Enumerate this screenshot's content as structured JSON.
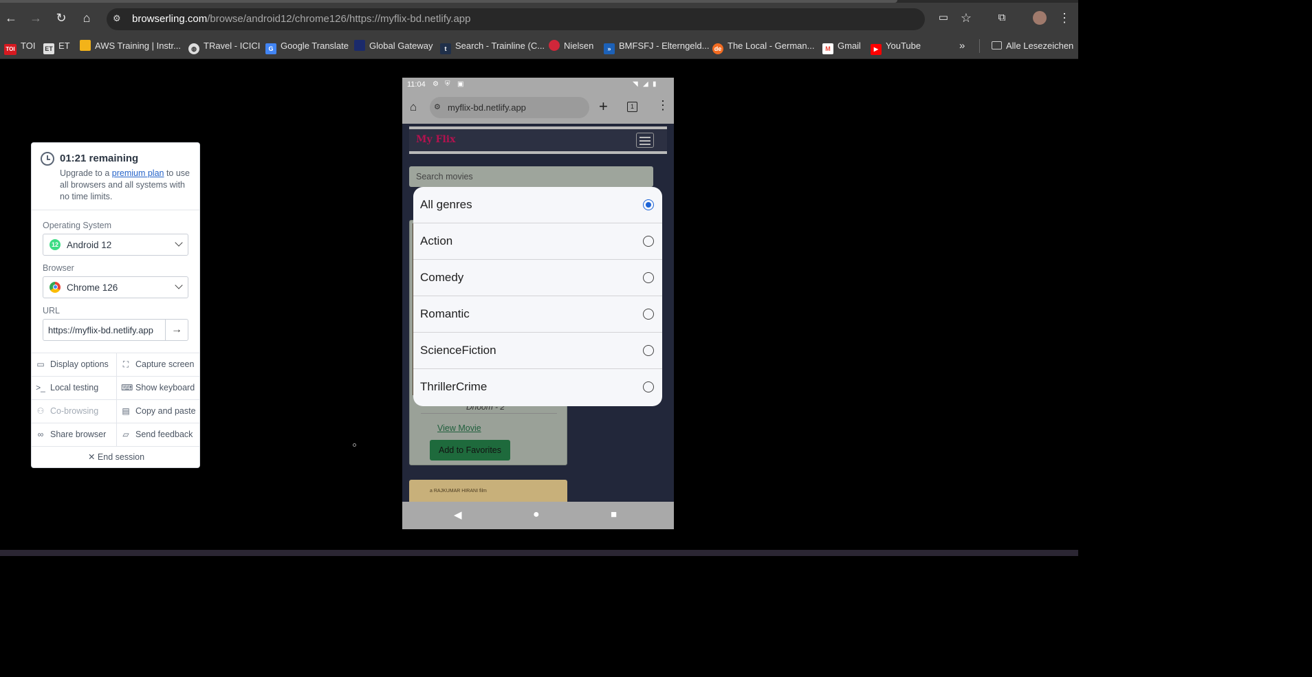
{
  "browser": {
    "omnibox": {
      "host": "browserling.com",
      "path": "/browse/android12/chrome126/https://myflix-bd.netlify.app"
    },
    "bookmarks": [
      {
        "label": "TOI",
        "fav": "TOI",
        "color": "#d71920"
      },
      {
        "label": "ET",
        "fav": "ET",
        "color": "#e0e0e0"
      },
      {
        "label": "AWS Training | Instr...",
        "fav": "",
        "color": "#f3b319"
      },
      {
        "label": "TRavel - ICICI",
        "fav": "",
        "color": "#dddddd"
      },
      {
        "label": "Google Translate",
        "fav": "G",
        "color": "#4285f4"
      },
      {
        "label": "Global Gateway",
        "fav": "",
        "color": "#1b2a6b"
      },
      {
        "label": "Search - Trainline (C...",
        "fav": "t",
        "color": "#20304a"
      },
      {
        "label": "Nielsen",
        "fav": "",
        "color": "#d0273a"
      },
      {
        "label": "BMFSFJ - Elterngeld...",
        "fav": "»",
        "color": "#1c61b8"
      },
      {
        "label": "The Local - German...",
        "fav": "de",
        "color": "#f26b21"
      },
      {
        "label": "Gmail",
        "fav": "M",
        "color": "#ea4335"
      },
      {
        "label": "YouTube",
        "fav": "▶",
        "color": "#ff0000"
      }
    ],
    "all_bookmarks": "Alle Lesezeichen"
  },
  "panel": {
    "timer_title": "01:21 remaining",
    "desc_pre": "Upgrade to a ",
    "desc_link": "premium plan",
    "desc_post": " to use all browsers and all systems with no time limits.",
    "os_label": "Operating System",
    "os_value": "Android 12",
    "browser_label": "Browser",
    "browser_value": "Chrome 126",
    "url_label": "URL",
    "url_value": "https://myflix-bd.netlify.app",
    "actions": {
      "display_options": "Display options",
      "capture_screen": "Capture screen",
      "local_testing": "Local testing",
      "show_keyboard": "Show keyboard",
      "co_browsing": "Co-browsing",
      "copy_paste": "Copy and paste",
      "share_browser": "Share browser",
      "send_feedback": "Send feedback"
    },
    "end_session": "End session"
  },
  "phone": {
    "time": "11:04",
    "address": "myflix-bd.netlify.app",
    "tab_count": "1",
    "brand": "My Flix",
    "search_placeholder": "Search movies",
    "card_title": "Dhoom - 2",
    "view_movie": "View Movie",
    "add_fav": "Add to Favorites",
    "poster2_caption": "a RAJKUMAR HIRANI film",
    "genres": [
      {
        "label": "All genres",
        "selected": true
      },
      {
        "label": "Action",
        "selected": false
      },
      {
        "label": "Comedy",
        "selected": false
      },
      {
        "label": "Romantic",
        "selected": false
      },
      {
        "label": "ScienceFiction",
        "selected": false
      },
      {
        "label": "ThrillerCrime",
        "selected": false
      }
    ]
  },
  "icons": {
    "back": "arrow-left-icon",
    "forward": "arrow-right-icon",
    "reload": "reload-icon",
    "home": "home-icon",
    "star": "star-icon",
    "extensions": "puzzle-icon",
    "menu": "kebab-icon",
    "folder": "folder-icon"
  }
}
